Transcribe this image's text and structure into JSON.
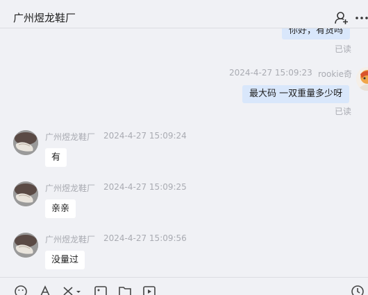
{
  "header": {
    "title": "广州煜龙鞋厂",
    "icons": [
      "user-add-icon",
      "more-icon"
    ]
  },
  "messages": [
    {
      "direction": "out",
      "text": "你好，有货吗",
      "status": "已读"
    },
    {
      "direction": "out",
      "sender": "rookie奇",
      "time": "2024-4-27 15:09:23",
      "text": "最大码 一双重量多少呀",
      "status": "已读"
    },
    {
      "direction": "in",
      "sender": "广州煜龙鞋厂",
      "time": "2024-4-27 15:09:24",
      "text": "有"
    },
    {
      "direction": "in",
      "sender": "广州煜龙鞋厂",
      "time": "2024-4-27 15:09:25",
      "text": "亲亲"
    },
    {
      "direction": "in",
      "sender": "广州煜龙鞋厂",
      "time": "2024-4-27 15:09:56",
      "text": "没量过"
    }
  ],
  "toolbar": {
    "icons": [
      "emoji-icon",
      "font-icon",
      "scissors-icon",
      "image-icon",
      "folder-icon",
      "video-icon",
      "history-icon"
    ]
  },
  "colors": {
    "background": "#f0f1f5",
    "bubble_out": "#d9e7fb",
    "bubble_in": "#ffffff",
    "meta_text": "#a9abb2"
  }
}
